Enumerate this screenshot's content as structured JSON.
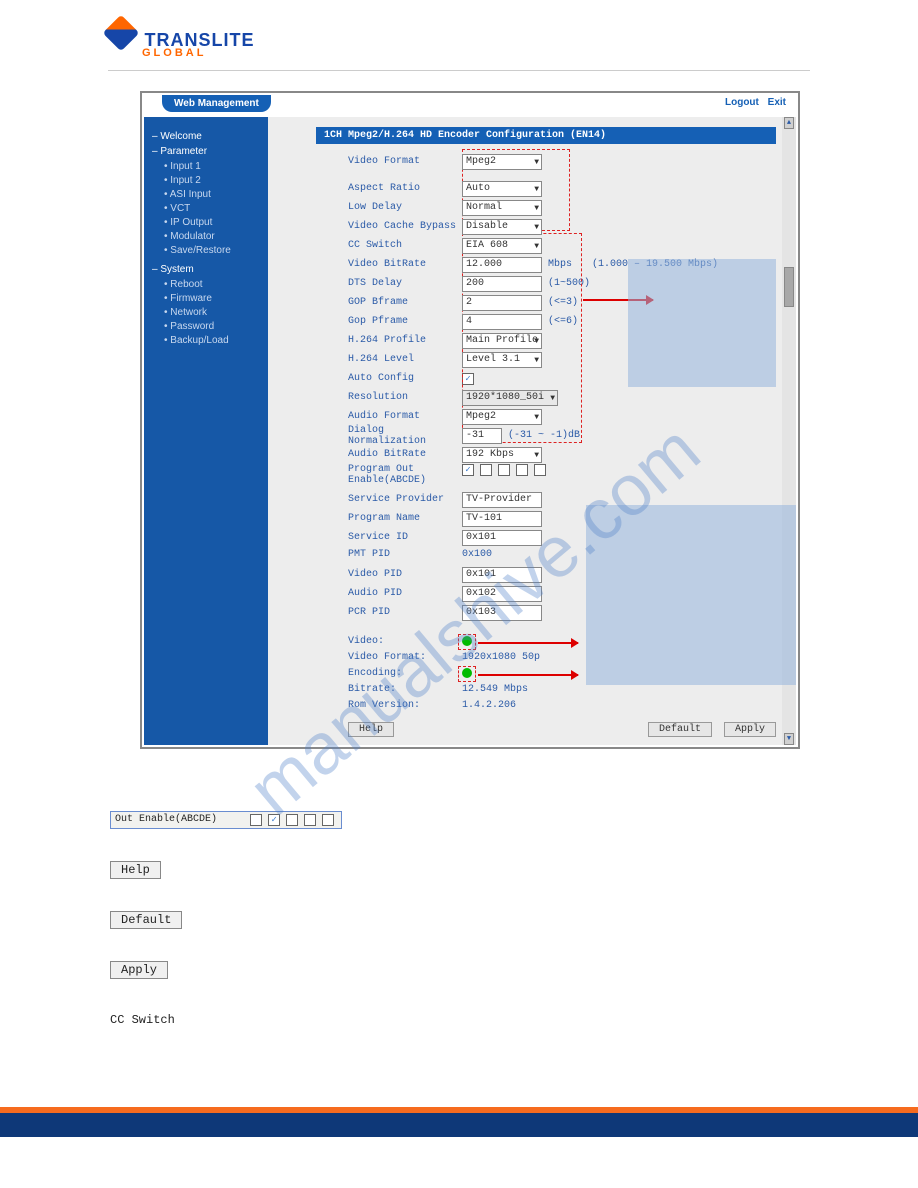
{
  "logo": {
    "brand": "TRANSLITE",
    "sub": "GLOBAL"
  },
  "topbar": {
    "tab": "Web Management",
    "logout": "Logout",
    "exit": "Exit"
  },
  "sidebar": {
    "welcome": "Welcome",
    "parameter": "Parameter",
    "param_items": [
      "Input 1",
      "Input 2",
      "ASI Input",
      "VCT",
      "IP Output",
      "Modulator",
      "Save/Restore"
    ],
    "system": "System",
    "system_items": [
      "Reboot",
      "Firmware",
      "Network",
      "Password",
      "Backup/Load"
    ]
  },
  "panel_title": "1CH Mpeg2/H.264 HD Encoder Configuration (EN14)",
  "form": {
    "video_format": {
      "label": "Video Format",
      "value": "Mpeg2"
    },
    "aspect_ratio": {
      "label": "Aspect Ratio",
      "value": "Auto"
    },
    "low_delay": {
      "label": "Low Delay",
      "value": "Normal"
    },
    "video_cache": {
      "label": "Video Cache Bypass",
      "value": "Disable"
    },
    "cc_switch": {
      "label": "CC Switch",
      "value": "EIA 608"
    },
    "video_bitrate": {
      "label": "Video BitRate",
      "value": "12.000",
      "suffix": "Mbps",
      "note": "(1.000 – 19.500 Mbps)"
    },
    "dts_delay": {
      "label": "DTS Delay",
      "value": "200",
      "suffix": "(1~500)"
    },
    "gop_bframe": {
      "label": "GOP Bframe",
      "value": "2",
      "suffix": "(<=3)"
    },
    "gop_pframe": {
      "label": "Gop Pframe",
      "value": "4",
      "suffix": "(<=6)"
    },
    "h264_profile": {
      "label": "H.264 Profile",
      "value": "Main Profile"
    },
    "h264_level": {
      "label": "H.264 Level",
      "value": "Level 3.1"
    },
    "auto_config": {
      "label": "Auto Config",
      "checked": true
    },
    "resolution": {
      "label": "Resolution",
      "value": "1920*1080_50i"
    },
    "audio_format": {
      "label": "Audio Format",
      "value": "Mpeg2"
    },
    "dialog_norm": {
      "label": "Dialog Normalization",
      "value": "-31",
      "suffix": "(-31 ~ -1)dB"
    },
    "audio_bitrate": {
      "label": "Audio BitRate",
      "value": "192 Kbps"
    },
    "prog_out": {
      "label1": "Program Out",
      "label2": "Enable(ABCDE)",
      "checks": [
        true,
        false,
        false,
        false,
        false
      ]
    },
    "service_provider": {
      "label": "Service Provider",
      "value": "TV-Provider"
    },
    "program_name": {
      "label": "Program Name",
      "value": "TV-101"
    },
    "service_id": {
      "label": "Service ID",
      "value": "0x101"
    },
    "pmt_pid": {
      "label": "PMT PID",
      "value": "0x100"
    },
    "video_pid": {
      "label": "Video PID",
      "value": "0x101"
    },
    "audio_pid": {
      "label": "Audio PID",
      "value": "0x102"
    },
    "pcr_pid": {
      "label": "PCR PID",
      "value": "0x103"
    }
  },
  "status": {
    "video": {
      "label": "Video:",
      "ok": true
    },
    "video_format": {
      "label": "Video Format:",
      "value": "1920x1080 50p"
    },
    "encoding": {
      "label": "Encoding:",
      "ok": true
    },
    "bitrate": {
      "label": "Bitrate:",
      "value": "12.549 Mbps"
    },
    "rom": {
      "label": "Rom Version:",
      "value": "1.4.2.206"
    }
  },
  "buttons": {
    "help": "Help",
    "default": "Default",
    "apply": "Apply"
  },
  "below": {
    "out_enable_label": "Out Enable(ABCDE)",
    "out_enable_checks": [
      false,
      true,
      false,
      false,
      false
    ],
    "help": "Help",
    "default": "Default",
    "apply": "Apply",
    "cc_switch": "CC Switch"
  },
  "watermark": "manualshive.com"
}
